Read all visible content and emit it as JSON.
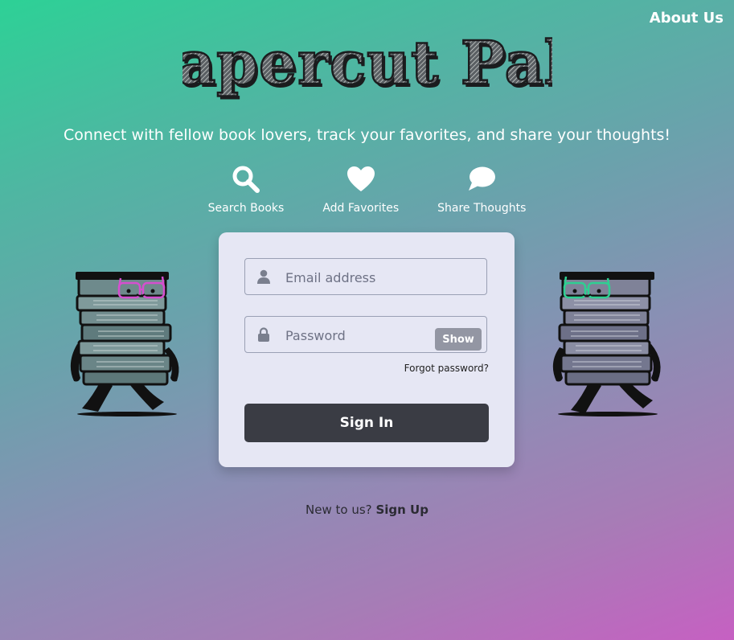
{
  "header": {
    "about_label": "About Us"
  },
  "logo": {
    "text": "Papercut Pals"
  },
  "tagline": "Connect with fellow book lovers, track your favorites, and share your thoughts!",
  "features": [
    {
      "icon": "search-icon",
      "label": "Search Books"
    },
    {
      "icon": "heart-icon",
      "label": "Add Favorites"
    },
    {
      "icon": "speech-bubble-icon",
      "label": "Share Thoughts"
    }
  ],
  "login": {
    "email_placeholder": "Email address",
    "password_placeholder": "Password",
    "show_label": "Show",
    "forgot_label": "Forgot password?",
    "signin_label": "Sign In"
  },
  "signup": {
    "prompt": "New to us?",
    "link_label": "Sign Up"
  },
  "colors": {
    "gradient_start": "#2dd196",
    "gradient_end": "#c660c2",
    "card_bg": "#e6e7f4",
    "button_dark": "#3a3c44",
    "glasses_left": "#d54fcf",
    "glasses_right": "#2fcf92"
  }
}
